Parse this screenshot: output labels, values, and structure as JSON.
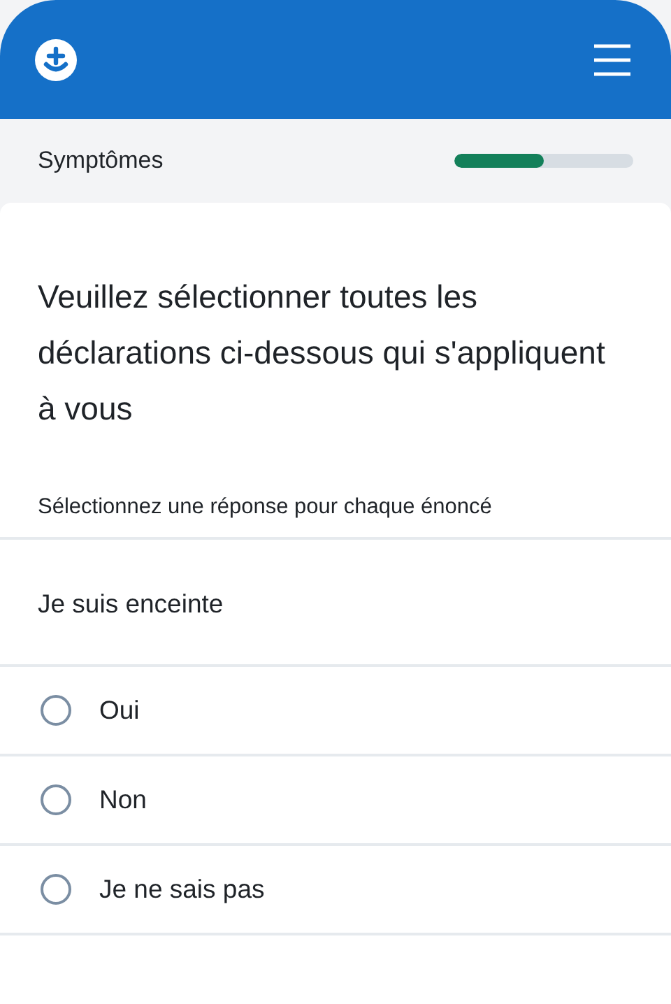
{
  "section": {
    "title": "Symptômes",
    "level": 0.5
  },
  "question": {
    "title": "Veuillez sélectionner toutes les déclarations ci-dessous qui s'appliquent à vous",
    "instruction": "Sélectionnez une réponse pour chaque énoncé"
  },
  "statements": [
    {
      "label": "Je suis enceinte",
      "options": [
        {
          "label": "Oui",
          "selected": false
        },
        {
          "label": "Non",
          "selected": false
        },
        {
          "label": "Je ne sais pas",
          "selected": false
        }
      ]
    }
  ]
}
